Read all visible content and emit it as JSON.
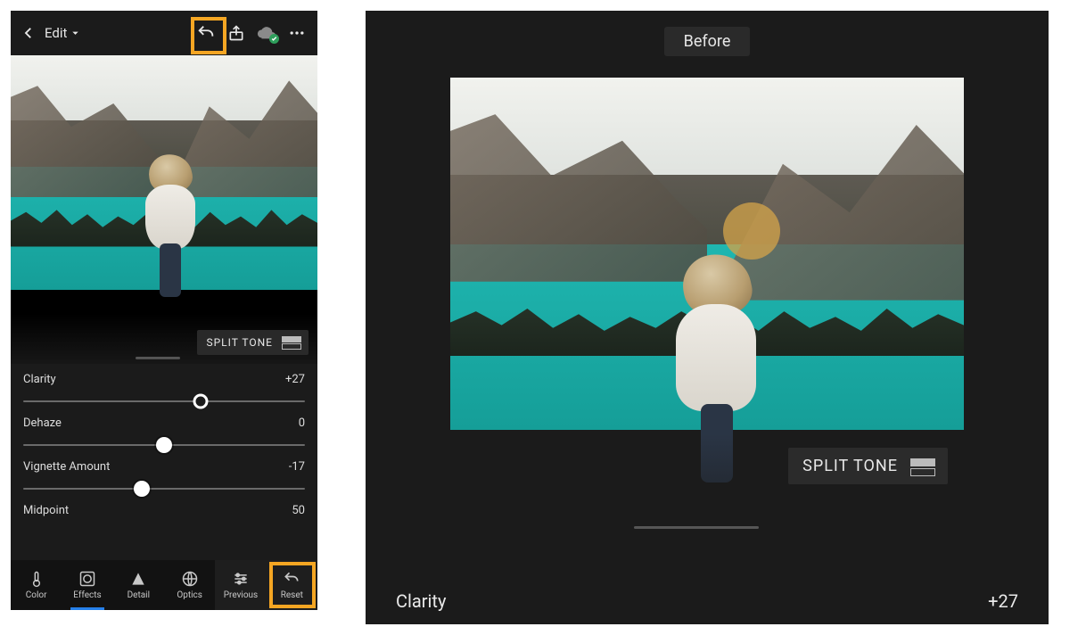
{
  "header": {
    "title": "Edit"
  },
  "panel": {
    "split_tone_label": "SPLIT TONE"
  },
  "sliders": [
    {
      "label": "Clarity",
      "value": "+27",
      "pos": 63
    },
    {
      "label": "Dehaze",
      "value": "0",
      "pos": 50
    },
    {
      "label": "Vignette Amount",
      "value": "-17",
      "pos": 42
    },
    {
      "label": "Midpoint",
      "value": "50",
      "pos": null
    }
  ],
  "tabs": [
    {
      "label": "Color",
      "icon": "thermometer-icon"
    },
    {
      "label": "Effects",
      "icon": "vignette-icon",
      "selected": true
    },
    {
      "label": "Detail",
      "icon": "triangle-icon"
    },
    {
      "label": "Optics",
      "icon": "lens-icon"
    },
    {
      "label": "Previous",
      "icon": "sliders-icon"
    },
    {
      "label": "Reset",
      "icon": "undo-icon"
    }
  ],
  "preview": {
    "badge": "Before",
    "split_tone_label": "SPLIT TONE",
    "bottom_label": "Clarity",
    "bottom_value": "+27"
  },
  "colors": {
    "highlight": "#f5a623",
    "accent": "#2680eb"
  }
}
